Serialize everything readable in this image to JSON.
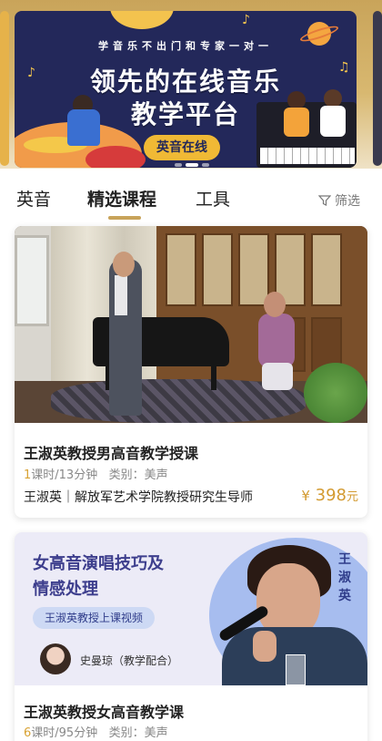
{
  "banner": {
    "subtitle": "学音乐不出门和专家一对一",
    "title_line1": "领先的在线音乐",
    "title_line2": "教学平台",
    "pill": "英音在线",
    "slide_count": 3,
    "active_slide": 1
  },
  "tabs": {
    "items": [
      "英音",
      "精选课程",
      "工具"
    ],
    "active": "精选课程",
    "filter_label": "筛选"
  },
  "courses": [
    {
      "title": "王淑英教授男高音教学授课",
      "lesson_count": "1",
      "duration": "课时/13分钟",
      "category": "类别：美声",
      "teacher": "王淑英｜解放军艺术学院教授研究生导师",
      "price_symbol": "¥",
      "price": "398",
      "price_unit": "元"
    },
    {
      "promo_title1": "女高音演唱技巧及",
      "promo_title2": "情感处理",
      "promo_tag": "王淑英教授上课视频",
      "promo_assistant": "史曼琼（教学配合）",
      "promo_vertical_name": "王淑英",
      "title": "王淑英教授女高音教学课",
      "lesson_count": "6",
      "duration": "课时/95分钟",
      "category": "类别：美声"
    }
  ],
  "colors": {
    "accent_gold": "#c8a35a",
    "price": "#d39a30",
    "banner_navy": "#23285a"
  }
}
